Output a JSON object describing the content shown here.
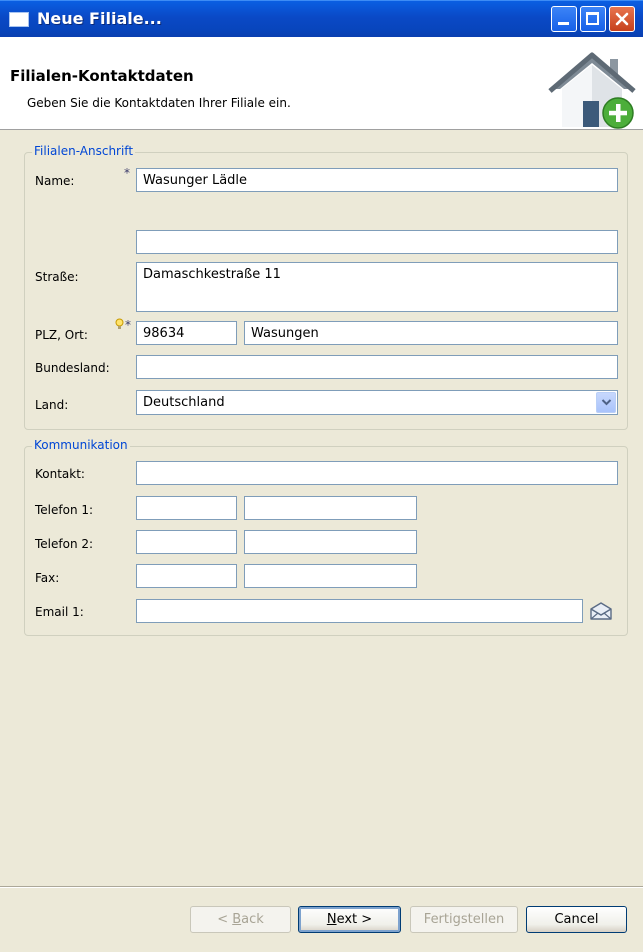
{
  "window": {
    "title": "Neue Filiale..."
  },
  "banner": {
    "title": "Filialen-Kontaktdaten",
    "subtitle": "Geben Sie die Kontaktdaten Ihrer Filiale ein."
  },
  "address": {
    "legend": "Filialen-Anschrift",
    "name_label": "Name:",
    "name_value": "Wasunger Lädle",
    "name2_value": "",
    "street_label": "Straße:",
    "street_value": "Damaschkestraße 11",
    "plz_label": "PLZ, Ort:",
    "plz_value": "98634",
    "city_value": "Wasungen",
    "state_label": "Bundesland:",
    "state_value": "",
    "country_label": "Land:",
    "country_value": "Deutschland"
  },
  "communication": {
    "legend": "Kommunikation",
    "contact_label": "Kontakt:",
    "contact_value": "",
    "phone1_label": "Telefon 1:",
    "phone2_label": "Telefon 2:",
    "fax_label": "Fax:",
    "email_label": "Email 1:",
    "email_value": ""
  },
  "required_mark": "*",
  "icons": {
    "window": "window-icon",
    "banner": "house-add-icon",
    "hint": "lightbulb-icon",
    "email": "envelope-icon",
    "dropdown": "chevron-down-icon"
  },
  "buttons": {
    "back_prefix": "< ",
    "back_key": "B",
    "back_rest": "ack",
    "next_key": "N",
    "next_rest": "ext >",
    "finish": "Fertigstellen",
    "cancel": "Cancel"
  }
}
